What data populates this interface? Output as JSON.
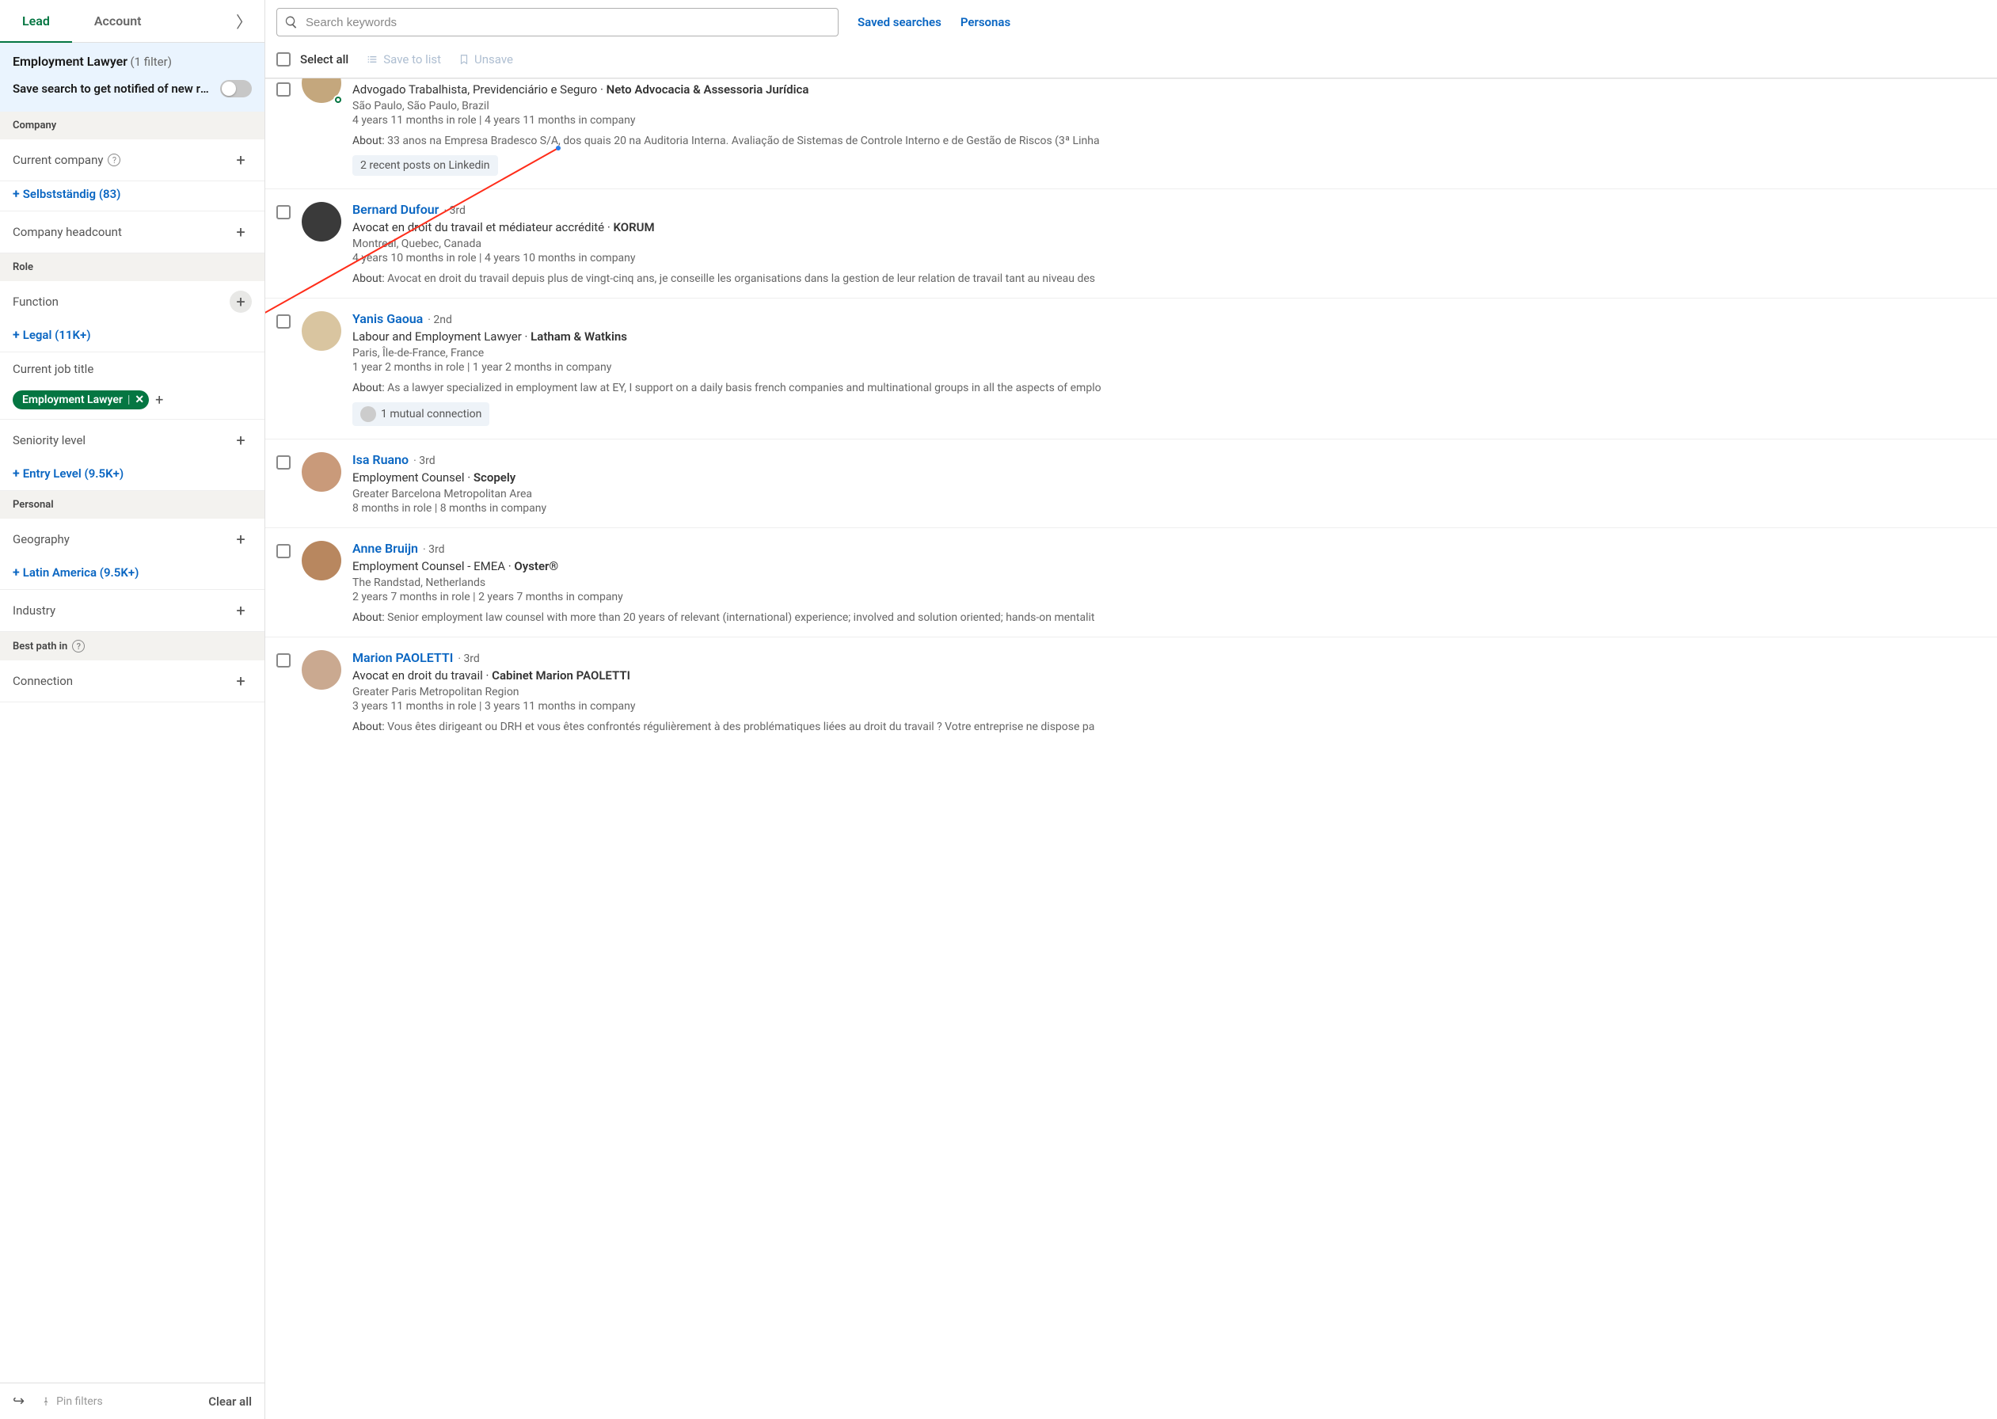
{
  "tabs": {
    "lead": "Lead",
    "account": "Account"
  },
  "savebox": {
    "title": "Employment Lawyer",
    "filter_count": "(1 filter)",
    "message": "Save search to get notified of new re…"
  },
  "sections": {
    "company": "Company",
    "role": "Role",
    "personal": "Personal",
    "best_path": "Best path in"
  },
  "filters": {
    "current_company": "Current company",
    "selbststandig": "Selbstständig (83)",
    "headcount": "Company headcount",
    "function": "Function",
    "legal": "Legal (11K+)",
    "current_title": "Current job title",
    "title_chip": "Employment Lawyer",
    "seniority": "Seniority level",
    "entry_level": "Entry Level (9.5K+)",
    "geography": "Geography",
    "latin_america": "Latin America (9.5K+)",
    "industry": "Industry",
    "connection": "Connection"
  },
  "bottom": {
    "pin": "Pin filters",
    "clear": "Clear all"
  },
  "top": {
    "search_placeholder": "Search keywords",
    "saved": "Saved searches",
    "personas": "Personas"
  },
  "toolbar": {
    "select_all": "Select all",
    "save_list": "Save to list",
    "unsave": "Unsave"
  },
  "about_label": "About:",
  "results": [
    {
      "name": "",
      "degree": "",
      "title_prefix": "Advogado Trabalhista, Previdenciário e Seguro",
      "company": "Neto Advocacia & Assessoria Jurídica",
      "location": "São Paulo, São Paulo, Brazil",
      "tenure": "4 years 11 months in role | 4 years 11 months in company",
      "about": "33 anos na Empresa Bradesco S/A, dos quais 20 na Auditoria Interna. Avaliação de Sistemas de Controle Interno e de Gestão de Riscos (3ª Linha",
      "badge": "2 recent posts on Linkedin",
      "presence": true,
      "partial_top": true
    },
    {
      "name": "Bernard Dufour",
      "degree": "· 3rd",
      "title_prefix": "Avocat en droit du travail et médiateur accrédité",
      "company": "KORUM",
      "location": "Montreal, Quebec, Canada",
      "tenure": "4 years 10 months in role | 4 years 10 months in company",
      "about": "Avocat en droit du travail depuis plus de vingt-cinq ans, je conseille les organisations dans la gestion de leur relation de travail tant au niveau des"
    },
    {
      "name": "Yanis Gaoua",
      "degree": "· 2nd",
      "title_prefix": "Labour and Employment Lawyer",
      "company": "Latham & Watkins",
      "location": "Paris, Île-de-France, France",
      "tenure": "1 year 2 months in role | 1 year 2 months in company",
      "about": "As a lawyer specialized in employment law at EY, I support on a daily basis french companies and multinational groups in all the aspects of emplo",
      "badge": "1 mutual connection",
      "badge_avatar": true
    },
    {
      "name": "Isa Ruano",
      "degree": "· 3rd",
      "title_prefix": "Employment Counsel",
      "company": "Scopely",
      "location": "Greater Barcelona Metropolitan Area",
      "tenure": "8 months in role | 8 months in company"
    },
    {
      "name": "Anne Bruijn",
      "degree": "· 3rd",
      "title_prefix": "Employment Counsel - EMEA",
      "company": "Oyster®",
      "location": "The Randstad, Netherlands",
      "tenure": "2 years 7 months in role | 2 years 7 months in company",
      "about": "Senior employment law counsel with more than 20 years of relevant (international) experience; involved and solution oriented; hands-on mentalit"
    },
    {
      "name": "Marion PAOLETTI",
      "degree": "· 3rd",
      "title_prefix": "Avocat en droit du travail",
      "company": "Cabinet Marion PAOLETTI",
      "location": "Greater Paris Metropolitan Region",
      "tenure": "3 years 11 months in role | 3 years 11 months in company",
      "about": "Vous êtes dirigeant ou DRH et vous êtes confrontés régulièrement à des problématiques liées au droit du travail ? Votre entreprise ne dispose pa"
    }
  ]
}
